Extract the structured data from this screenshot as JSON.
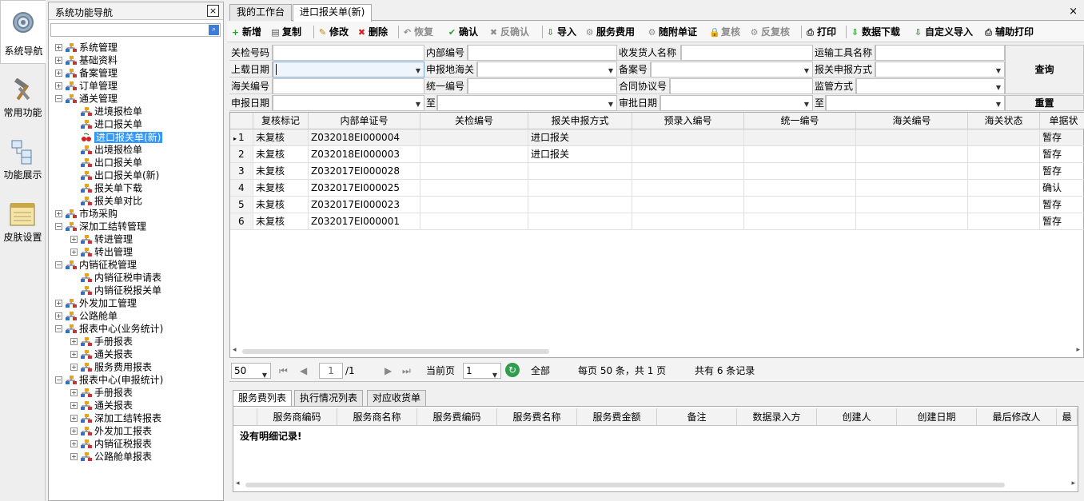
{
  "iconbar": {
    "items": [
      {
        "label": "系统导航",
        "icon": "gear-icon",
        "active": true
      },
      {
        "label": "常用功能",
        "icon": "hammer-wrench-icon",
        "active": false
      },
      {
        "label": "功能展示",
        "icon": "flowchart-icon",
        "active": false
      },
      {
        "label": "皮肤设置",
        "icon": "notepad-icon",
        "active": false
      }
    ]
  },
  "nav": {
    "title": "系统功能导航",
    "close_label": "×",
    "search_value": "",
    "tree": [
      {
        "label": "系统管理",
        "level": 0,
        "toggle": "+"
      },
      {
        "label": "基础资料",
        "level": 0,
        "toggle": "+"
      },
      {
        "label": "备案管理",
        "level": 0,
        "toggle": "+"
      },
      {
        "label": "订单管理",
        "level": 0,
        "toggle": "+"
      },
      {
        "label": "通关管理",
        "level": 0,
        "toggle": "−"
      },
      {
        "label": "进境报检单",
        "level": 1,
        "toggle": ""
      },
      {
        "label": "进口报关单",
        "level": 1,
        "toggle": ""
      },
      {
        "label": "进口报关单(新)",
        "level": 1,
        "toggle": "",
        "selected": true
      },
      {
        "label": "出境报检单",
        "level": 1,
        "toggle": ""
      },
      {
        "label": "出口报关单",
        "level": 1,
        "toggle": ""
      },
      {
        "label": "出口报关单(新)",
        "level": 1,
        "toggle": ""
      },
      {
        "label": "报关单下载",
        "level": 1,
        "toggle": ""
      },
      {
        "label": "报关单对比",
        "level": 1,
        "toggle": ""
      },
      {
        "label": "市场采购",
        "level": 0,
        "toggle": "+"
      },
      {
        "label": "深加工结转管理",
        "level": 0,
        "toggle": "−"
      },
      {
        "label": "转进管理",
        "level": 1,
        "toggle": "+"
      },
      {
        "label": "转出管理",
        "level": 1,
        "toggle": "+"
      },
      {
        "label": "内销征税管理",
        "level": 0,
        "toggle": "−"
      },
      {
        "label": "内销征税申请表",
        "level": 1,
        "toggle": ""
      },
      {
        "label": "内销征税报关单",
        "level": 1,
        "toggle": ""
      },
      {
        "label": "外发加工管理",
        "level": 0,
        "toggle": "+"
      },
      {
        "label": "公路舱单",
        "level": 0,
        "toggle": "+"
      },
      {
        "label": "报表中心(业务统计)",
        "level": 0,
        "toggle": "−"
      },
      {
        "label": "手册报表",
        "level": 1,
        "toggle": "+"
      },
      {
        "label": "通关报表",
        "level": 1,
        "toggle": "+"
      },
      {
        "label": "服务费用报表",
        "level": 1,
        "toggle": "+"
      },
      {
        "label": "报表中心(申报统计)",
        "level": 0,
        "toggle": "−"
      },
      {
        "label": "手册报表",
        "level": 1,
        "toggle": "+"
      },
      {
        "label": "通关报表",
        "level": 1,
        "toggle": "+"
      },
      {
        "label": "深加工结转报表",
        "level": 1,
        "toggle": "+"
      },
      {
        "label": "外发加工报表",
        "level": 1,
        "toggle": "+"
      },
      {
        "label": "内销征税报表",
        "level": 1,
        "toggle": "+"
      },
      {
        "label": "公路舱单报表",
        "level": 1,
        "toggle": "+"
      }
    ]
  },
  "tabs": [
    {
      "label": "我的工作台",
      "active": false
    },
    {
      "label": "进口报关单(新)",
      "active": true
    }
  ],
  "tab_close": "×",
  "toolbar": [
    {
      "label": "新增",
      "icon": "add-icon",
      "glyph": "+",
      "color": "#2a9d2a",
      "disabled": false
    },
    {
      "label": "复制",
      "icon": "copy-icon",
      "glyph": "▤",
      "color": "#555555",
      "disabled": false
    },
    {
      "label": "修改",
      "icon": "edit-icon",
      "glyph": "✎",
      "color": "#c08000",
      "disabled": false
    },
    {
      "label": "删除",
      "icon": "delete-icon",
      "glyph": "✖",
      "color": "#d42020",
      "disabled": false
    },
    {
      "label": "恢复",
      "icon": "undo-icon",
      "glyph": "↶",
      "color": "#8c8c8c",
      "disabled": true
    },
    {
      "label": "确认",
      "icon": "check-icon",
      "glyph": "✔",
      "color": "#2a9d2a",
      "disabled": false
    },
    {
      "label": "反确认",
      "icon": "uncheck-icon",
      "glyph": "✖",
      "color": "#8c8c8c",
      "disabled": true
    },
    {
      "label": "导入",
      "icon": "import-icon",
      "glyph": "⇩",
      "color": "#2a9d2a",
      "disabled": false
    },
    {
      "label": "服务费用",
      "icon": "service-fee-gear-icon",
      "glyph": "⚙",
      "color": "#8c8c8c",
      "disabled": false
    },
    {
      "label": "随附单证",
      "icon": "attachment-gear-icon",
      "glyph": "⚙",
      "color": "#8c8c8c",
      "disabled": false
    },
    {
      "label": "复核",
      "icon": "lock-icon",
      "glyph": "🔒",
      "color": "#8c8c8c",
      "disabled": true
    },
    {
      "label": "反复核",
      "icon": "unreview-gear-icon",
      "glyph": "⚙",
      "color": "#8c8c8c",
      "disabled": true
    },
    {
      "label": "打印",
      "icon": "printer-icon",
      "glyph": "⎙",
      "color": "#333333",
      "disabled": false
    },
    {
      "label": "数据下载",
      "icon": "download-icon",
      "glyph": "⇩",
      "color": "#2a9d2a",
      "disabled": false
    },
    {
      "label": "自定义导入",
      "icon": "custom-import-icon",
      "glyph": "⇩",
      "color": "#2a9d2a",
      "disabled": false
    },
    {
      "label": "辅助打印",
      "icon": "aux-printer-icon",
      "glyph": "⎙",
      "color": "#333333",
      "disabled": false
    }
  ],
  "form": {
    "row1": {
      "l1": "关检号码",
      "l2": "内部编号",
      "l3": "收发货人名称",
      "l4": "运输工具名称"
    },
    "row2": {
      "l1": "上载日期",
      "l2": "申报地海关",
      "l3": "备案号",
      "l4": "报关申报方式"
    },
    "row3": {
      "l1": "海关编号",
      "l2": "统一编号",
      "l3": "合同协议号",
      "l4": "监管方式"
    },
    "row4": {
      "l1": "申报日期",
      "l2": "至",
      "l3": "审批日期",
      "l4": "至"
    },
    "query_label": "查询",
    "reset_label": "重置"
  },
  "grid": {
    "columns": [
      "",
      "复核标记",
      "内部单证号",
      "关检编号",
      "报关申报方式",
      "预录入编号",
      "统一编号",
      "海关编号",
      "海关状态",
      "单据状"
    ],
    "rows": [
      {
        "no": "1",
        "marker": "▸",
        "review": "未复核",
        "doc": "Z032018EI000004",
        "gj": "",
        "mode": "进口报关",
        "pre": "",
        "uni": "",
        "cust": "",
        "cstat": "",
        "status": "暂存"
      },
      {
        "no": "2",
        "marker": "",
        "review": "未复核",
        "doc": "Z032018EI000003",
        "gj": "",
        "mode": "进口报关",
        "pre": "",
        "uni": "",
        "cust": "",
        "cstat": "",
        "status": "暂存"
      },
      {
        "no": "3",
        "marker": "",
        "review": "未复核",
        "doc": "Z032017EI000028",
        "gj": "",
        "mode": "",
        "pre": "",
        "uni": "",
        "cust": "",
        "cstat": "",
        "status": "暂存"
      },
      {
        "no": "4",
        "marker": "",
        "review": "未复核",
        "doc": "Z032017EI000025",
        "gj": "",
        "mode": "",
        "pre": "",
        "uni": "",
        "cust": "",
        "cstat": "",
        "status": "确认"
      },
      {
        "no": "5",
        "marker": "",
        "review": "未复核",
        "doc": "Z032017EI000023",
        "gj": "",
        "mode": "",
        "pre": "",
        "uni": "",
        "cust": "",
        "cstat": "",
        "status": "暂存"
      },
      {
        "no": "6",
        "marker": "",
        "review": "未复核",
        "doc": "Z032017EI000001",
        "gj": "",
        "mode": "",
        "pre": "",
        "uni": "",
        "cust": "",
        "cstat": "",
        "status": "暂存"
      }
    ]
  },
  "pager": {
    "page_size": "50",
    "current_page": "1",
    "total_pages": "/1",
    "current_page_label": "当前页",
    "current_page_select": "1",
    "all_label": "全部",
    "summary": "每页 50 条，共 1 页",
    "total": "共有 6 条记录"
  },
  "bottom": {
    "tabs": [
      "服务费列表",
      "执行情况列表",
      "对应收货单"
    ],
    "columns": [
      "",
      "服务商编码",
      "服务商名称",
      "服务费编码",
      "服务费名称",
      "服务费金额",
      "备注",
      "数据录入方",
      "创建人",
      "创建日期",
      "最后修改人",
      "最"
    ],
    "empty_text": "没有明细记录!"
  }
}
